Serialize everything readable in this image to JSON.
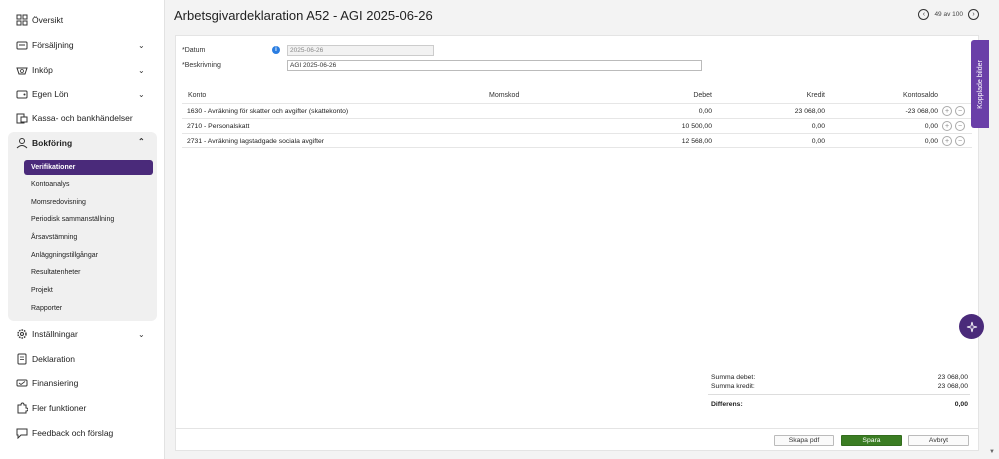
{
  "sidebar": {
    "items": [
      {
        "label": "Översikt",
        "icon": "grid-icon"
      },
      {
        "label": "Försäljning",
        "icon": "register-icon"
      },
      {
        "label": "Inköp",
        "icon": "basket-icon"
      },
      {
        "label": "Egen Lön",
        "icon": "wallet-icon"
      },
      {
        "label": "Kassa- och bankhändelser",
        "icon": "bank-icon"
      },
      {
        "label": "Bokföring",
        "icon": "ledger-icon"
      },
      {
        "label": "Inställningar",
        "icon": "gear-icon"
      },
      {
        "label": "Deklaration",
        "icon": "declaration-icon"
      },
      {
        "label": "Finansiering",
        "icon": "finance-icon"
      },
      {
        "label": "Fler funktioner",
        "icon": "puzzle-icon"
      },
      {
        "label": "Feedback och förslag",
        "icon": "feedback-icon"
      }
    ],
    "bokforing_sub": [
      "Verifikationer",
      "Kontoanalys",
      "Momsredovisning",
      "Periodisk sammanställning",
      "Årsavstämning",
      "Anläggningstillgångar",
      "Resultatenheter",
      "Projekt",
      "Rapporter"
    ]
  },
  "header": {
    "title": "Arbetsgivardeklaration A52  -  AGI 2025-06-26",
    "pager_text": "49 av 100"
  },
  "form": {
    "datum_label": "*Datum",
    "datum_value": "2025-06-26",
    "beskrivning_label": "*Beskrivning",
    "beskrivning_value": "AGI 2025-06-26"
  },
  "table": {
    "headers": {
      "konto": "Konto",
      "momskod": "Momskod",
      "debet": "Debet",
      "kredit": "Kredit",
      "kontosaldo": "Kontosaldo"
    },
    "rows": [
      {
        "konto": "1630 - Avräkning för skatter och avgifter (skattekonto)",
        "momskod": "",
        "debet": "0,00",
        "kredit": "23 068,00",
        "kontosaldo": "-23 068,00"
      },
      {
        "konto": "2710 - Personalskatt",
        "momskod": "",
        "debet": "10 500,00",
        "kredit": "0,00",
        "kontosaldo": "0,00"
      },
      {
        "konto": "2731 - Avräkning lagstadgade sociala avgifter",
        "momskod": "",
        "debet": "12 568,00",
        "kredit": "0,00",
        "kontosaldo": "0,00"
      }
    ]
  },
  "summary": {
    "debet_label": "Summa debet:",
    "debet_value": "23 068,00",
    "kredit_label": "Summa kredit:",
    "kredit_value": "23 068,00",
    "diff_label": "Differens:",
    "diff_value": "0,00"
  },
  "footer": {
    "pdf_label": "Skapa pdf",
    "save_label": "Spara",
    "cancel_label": "Avbryt"
  },
  "side_tab": {
    "label": "Kopplade bilder"
  },
  "colors": {
    "accent": "#4a2a7a",
    "side_tab": "#6a3fa8",
    "save": "#3b7d23",
    "info": "#2a7de1"
  }
}
